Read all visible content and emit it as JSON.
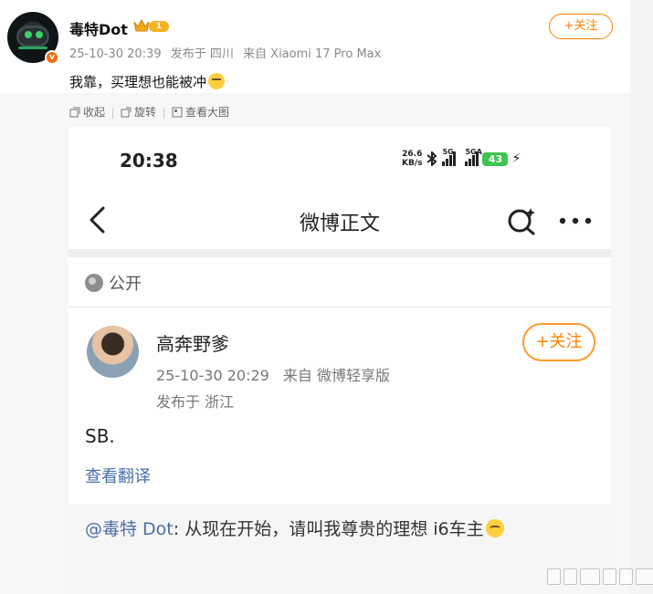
{
  "post": {
    "author": "毒特Dot",
    "vip_level": "1",
    "verified_mark": "v",
    "time": "25-10-30 20:39",
    "published_in": "发布于 四川",
    "device": "来自 Xiaomi 17 Pro Max",
    "follow_label": "+关注",
    "text": "我靠，买理想也能被冲",
    "toolbar": {
      "collapse": "收起",
      "rotate": "旋转",
      "view_large": "查看大图"
    }
  },
  "screenshot": {
    "status_time": "20:38",
    "net_speed_value": "26.6",
    "net_speed_unit": "KB/s",
    "sig1_label": "5G",
    "sig2_label": "5GA",
    "battery": "43",
    "nav_title": "微博正文",
    "visibility": "公开",
    "author": "高奔野爹",
    "follow_label": "+关注",
    "time": "25-10-30 20:29",
    "source": "来自 微博轻享版",
    "location": "发布于 浙江",
    "text": "SB.",
    "translate_label": "查看翻译",
    "repost_mention": "@毒特 Dot",
    "repost_text": ": 从现在开始，请叫我尊贵的理想 i6车主"
  },
  "colors": {
    "accent_orange": "#ff8200",
    "link_blue": "#4a6ea9",
    "battery_green": "#3ec44f"
  }
}
